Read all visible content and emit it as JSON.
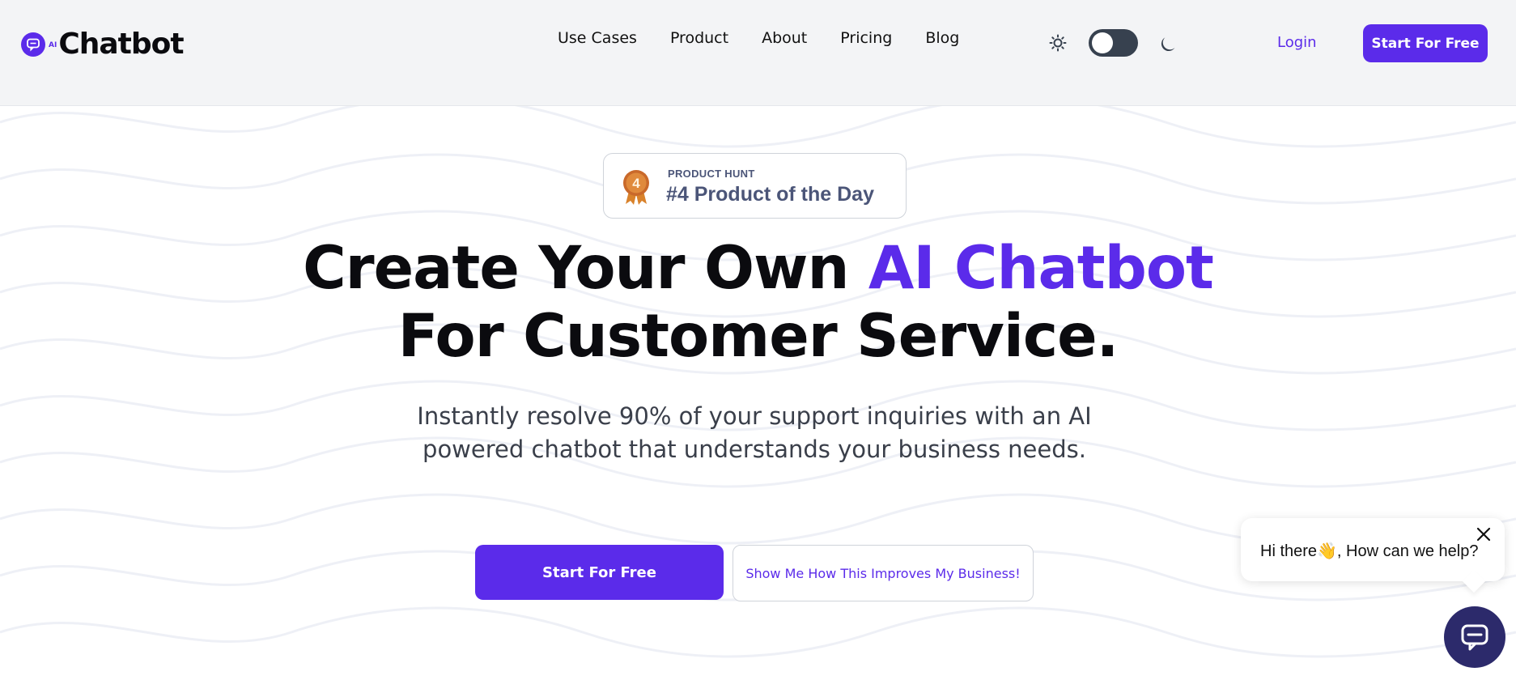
{
  "brand": {
    "ai_mark": "AI",
    "name": "Chatbot",
    "color": "#5b2bea"
  },
  "nav": {
    "items": [
      "Use Cases",
      "Product",
      "About",
      "Pricing",
      "Blog"
    ]
  },
  "header": {
    "theme_toggle": {
      "state": "light",
      "icons": [
        "sun-icon",
        "moon-icon"
      ]
    },
    "login_label": "Login",
    "cta_label": "Start For Free"
  },
  "product_hunt": {
    "medal_number": "4",
    "label": "PRODUCT HUNT",
    "title": "#4 Product of the Day"
  },
  "hero": {
    "headline_part1": "Create Your Own ",
    "headline_accent": "AI Chatbot",
    "headline_line2": "For Customer Service.",
    "subtext": "Instantly resolve 90% of your support inquiries with an AI powered chatbot that understands your business needs.",
    "primary_cta": "Start For Free",
    "secondary_cta": "Show Me How This Improves My Business!"
  },
  "chat_widget": {
    "greeting": "Hi there👋, How can we help?",
    "launcher_icon": "chat-icon",
    "close_icon": "close-icon"
  },
  "colors": {
    "accent": "#5b2bea",
    "header_bg": "#f3f4f6",
    "launcher_bg": "#2c2a6b"
  }
}
